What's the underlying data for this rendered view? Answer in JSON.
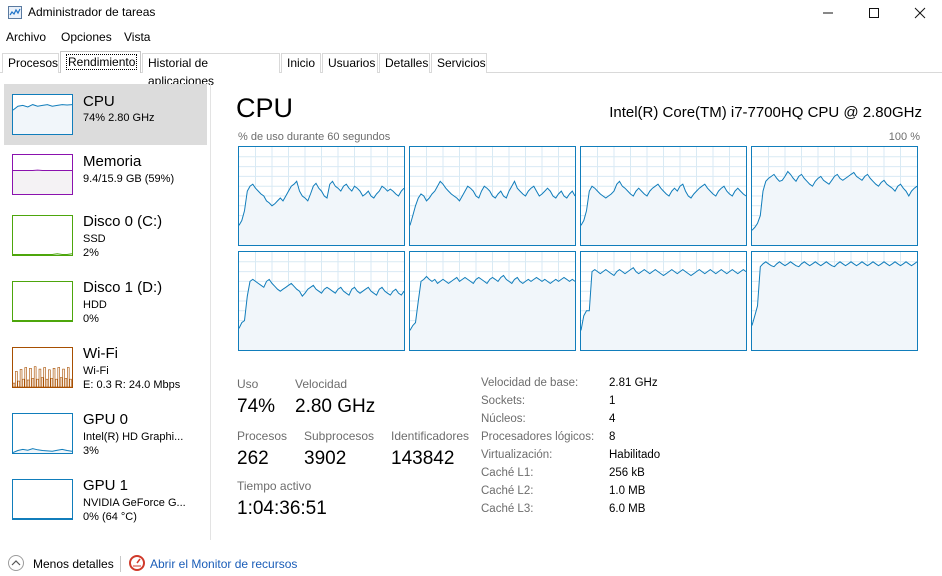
{
  "window": {
    "title": "Administrador de tareas"
  },
  "menu": [
    "Archivo",
    "Opciones",
    "Vista"
  ],
  "tabs": [
    "Procesos",
    "Rendimiento",
    "Historial de aplicaciones",
    "Inicio",
    "Usuarios",
    "Detalles",
    "Servicios"
  ],
  "active_tab": "Rendimiento",
  "sidebar": {
    "items": [
      {
        "name": "CPU",
        "sub1": "74% 2.80 GHz",
        "sub2": "",
        "color": "#117dbb"
      },
      {
        "name": "Memoria",
        "sub1": "9.4/15.9 GB (59%)",
        "sub2": "",
        "color": "#8b12ae"
      },
      {
        "name": "Disco 0 (C:)",
        "sub1": "SSD",
        "sub2": "2%",
        "color": "#4da60c"
      },
      {
        "name": "Disco 1 (D:)",
        "sub1": "HDD",
        "sub2": "0%",
        "color": "#4da60c"
      },
      {
        "name": "Wi-Fi",
        "sub1": "Wi-Fi",
        "sub2": "E: 0.3  R: 24.0 Mbps",
        "color": "#a74f01"
      },
      {
        "name": "GPU 0",
        "sub1": "Intel(R) HD Graphi...",
        "sub2": "3%",
        "color": "#117dbb"
      },
      {
        "name": "GPU 1",
        "sub1": "NVIDIA GeForce G...",
        "sub2": "0% (64 °C)",
        "color": "#117dbb"
      }
    ]
  },
  "main": {
    "title": "CPU",
    "model": "Intel(R) Core(TM) i7-7700HQ CPU @ 2.80GHz",
    "graph_label": "% de uso durante 60 segundos",
    "graph_max": "100 %",
    "stats": {
      "uso_label": "Uso",
      "uso_value": "74%",
      "velocidad_label": "Velocidad",
      "velocidad_value": "2.80 GHz",
      "procesos_label": "Procesos",
      "procesos_value": "262",
      "subprocesos_label": "Subprocesos",
      "subprocesos_value": "3902",
      "identificadores_label": "Identificadores",
      "identificadores_value": "143842",
      "tiempo_label": "Tiempo activo",
      "tiempo_value": "1:04:36:51"
    },
    "specs": [
      {
        "label": "Velocidad de base:",
        "value": "2.81 GHz"
      },
      {
        "label": "Sockets:",
        "value": "1"
      },
      {
        "label": "Núcleos:",
        "value": "4"
      },
      {
        "label": "Procesadores lógicos:",
        "value": "8"
      },
      {
        "label": "Virtualización:",
        "value": "Habilitado"
      },
      {
        "label": "Caché L1:",
        "value": "256 kB"
      },
      {
        "label": "Caché L2:",
        "value": "1.0 MB"
      },
      {
        "label": "Caché L3:",
        "value": "6.0 MB"
      }
    ]
  },
  "footer": {
    "less_details": "Menos detalles",
    "resource_monitor": "Abrir el Monitor de recursos"
  },
  "core_usage": [
    [
      20,
      25,
      35,
      55,
      60,
      62,
      58,
      55,
      52,
      50,
      45,
      43,
      40,
      42,
      45,
      48,
      45,
      50,
      55,
      60,
      62,
      65,
      55,
      50,
      48,
      45,
      52,
      60,
      63,
      58,
      55,
      50,
      48,
      62,
      65,
      60,
      58,
      55,
      60,
      62,
      58,
      55,
      60,
      58,
      55,
      50,
      52,
      55,
      50,
      48,
      52,
      55,
      60,
      58,
      55,
      57,
      55,
      52,
      50,
      55,
      58
    ],
    [
      20,
      30,
      40,
      48,
      52,
      50,
      45,
      48,
      52,
      55,
      60,
      65,
      62,
      58,
      55,
      52,
      50,
      48,
      45,
      50,
      55,
      60,
      58,
      55,
      50,
      48,
      55,
      60,
      58,
      55,
      50,
      48,
      52,
      55,
      50,
      48,
      55,
      60,
      65,
      58,
      55,
      52,
      50,
      55,
      58,
      60,
      55,
      50,
      52,
      55,
      58,
      55,
      50,
      48,
      52,
      55,
      50,
      48,
      52,
      55,
      50
    ],
    [
      20,
      25,
      35,
      55,
      60,
      58,
      55,
      52,
      50,
      48,
      50,
      52,
      55,
      62,
      65,
      60,
      58,
      55,
      52,
      50,
      55,
      58,
      55,
      52,
      50,
      55,
      58,
      60,
      62,
      58,
      55,
      52,
      50,
      55,
      58,
      55,
      60,
      62,
      55,
      50,
      48,
      52,
      55,
      58,
      60,
      62,
      58,
      55,
      52,
      50,
      55,
      58,
      60,
      55,
      52,
      50,
      55,
      58,
      55,
      52,
      50
    ],
    [
      15,
      18,
      22,
      30,
      55,
      65,
      68,
      70,
      72,
      68,
      65,
      66,
      70,
      75,
      72,
      68,
      65,
      70,
      72,
      68,
      65,
      62,
      60,
      65,
      68,
      70,
      66,
      64,
      62,
      66,
      70,
      72,
      68,
      66,
      68,
      70,
      72,
      74,
      70,
      68,
      66,
      70,
      72,
      68,
      65,
      62,
      60,
      64,
      66,
      62,
      60,
      58,
      55,
      60,
      62,
      58,
      55,
      50,
      55,
      58,
      60
    ],
    [
      22,
      28,
      30,
      55,
      70,
      72,
      70,
      68,
      66,
      64,
      70,
      72,
      68,
      65,
      62,
      60,
      62,
      64,
      66,
      68,
      65,
      62,
      60,
      55,
      58,
      62,
      64,
      66,
      62,
      60,
      58,
      62,
      64,
      62,
      60,
      58,
      62,
      64,
      60,
      58,
      56,
      62,
      64,
      60,
      58,
      60,
      62,
      64,
      60,
      58,
      56,
      62,
      64,
      60,
      58,
      56,
      60,
      62,
      58,
      56,
      60
    ],
    [
      20,
      25,
      28,
      50,
      70,
      72,
      75,
      72,
      70,
      72,
      68,
      70,
      72,
      70,
      68,
      70,
      72,
      74,
      70,
      72,
      74,
      72,
      70,
      68,
      72,
      74,
      72,
      70,
      68,
      72,
      74,
      72,
      70,
      74,
      76,
      72,
      70,
      68,
      72,
      74,
      70,
      68,
      70,
      72,
      70,
      72,
      74,
      72,
      70,
      72,
      70,
      68,
      70,
      72,
      70,
      72,
      74,
      72,
      70,
      72,
      70
    ],
    [
      20,
      35,
      40,
      40,
      80,
      82,
      80,
      78,
      80,
      82,
      80,
      78,
      76,
      80,
      82,
      80,
      78,
      80,
      82,
      84,
      80,
      78,
      80,
      82,
      80,
      78,
      80,
      82,
      80,
      78,
      76,
      78,
      80,
      82,
      80,
      78,
      80,
      82,
      80,
      78,
      76,
      78,
      80,
      82,
      80,
      78,
      80,
      82,
      80,
      78,
      80,
      82,
      80,
      78,
      80,
      82,
      80,
      78,
      80,
      82,
      80
    ],
    [
      25,
      35,
      45,
      85,
      88,
      90,
      88,
      86,
      85,
      88,
      90,
      88,
      86,
      88,
      90,
      88,
      86,
      85,
      88,
      90,
      88,
      86,
      88,
      90,
      88,
      86,
      88,
      90,
      88,
      86,
      85,
      88,
      90,
      88,
      86,
      88,
      90,
      88,
      86,
      88,
      90,
      88,
      86,
      88,
      90,
      88,
      86,
      88,
      90,
      88,
      86,
      88,
      90,
      88,
      86,
      88,
      90,
      88,
      86,
      88,
      90
    ]
  ],
  "sidebar_usage": {
    "cpu": [
      60,
      70,
      72,
      68,
      74,
      70,
      72,
      74,
      70,
      72,
      74,
      73,
      74
    ],
    "memoria": [
      59,
      59,
      59,
      59,
      59,
      60,
      59,
      59,
      59,
      59,
      59,
      59,
      59
    ],
    "disco0": [
      0,
      0,
      0,
      0,
      0,
      0,
      0,
      0,
      0,
      2,
      0,
      0,
      2
    ],
    "disco1": [
      0,
      0,
      0,
      0,
      0,
      0,
      0,
      0,
      0,
      0,
      0,
      0,
      0
    ],
    "wifi": [
      10,
      40,
      15,
      45,
      20,
      50,
      18,
      48,
      22,
      52,
      20,
      46,
      24,
      50,
      20,
      44,
      22,
      48,
      20,
      50,
      24,
      46,
      22,
      50,
      20
    ],
    "gpu0": [
      0,
      5,
      8,
      6,
      10,
      7,
      5,
      4,
      3,
      6,
      8,
      5,
      3
    ],
    "gpu1": [
      0,
      0,
      0,
      0,
      0,
      0,
      0,
      0,
      0,
      0,
      0,
      0,
      0
    ]
  }
}
